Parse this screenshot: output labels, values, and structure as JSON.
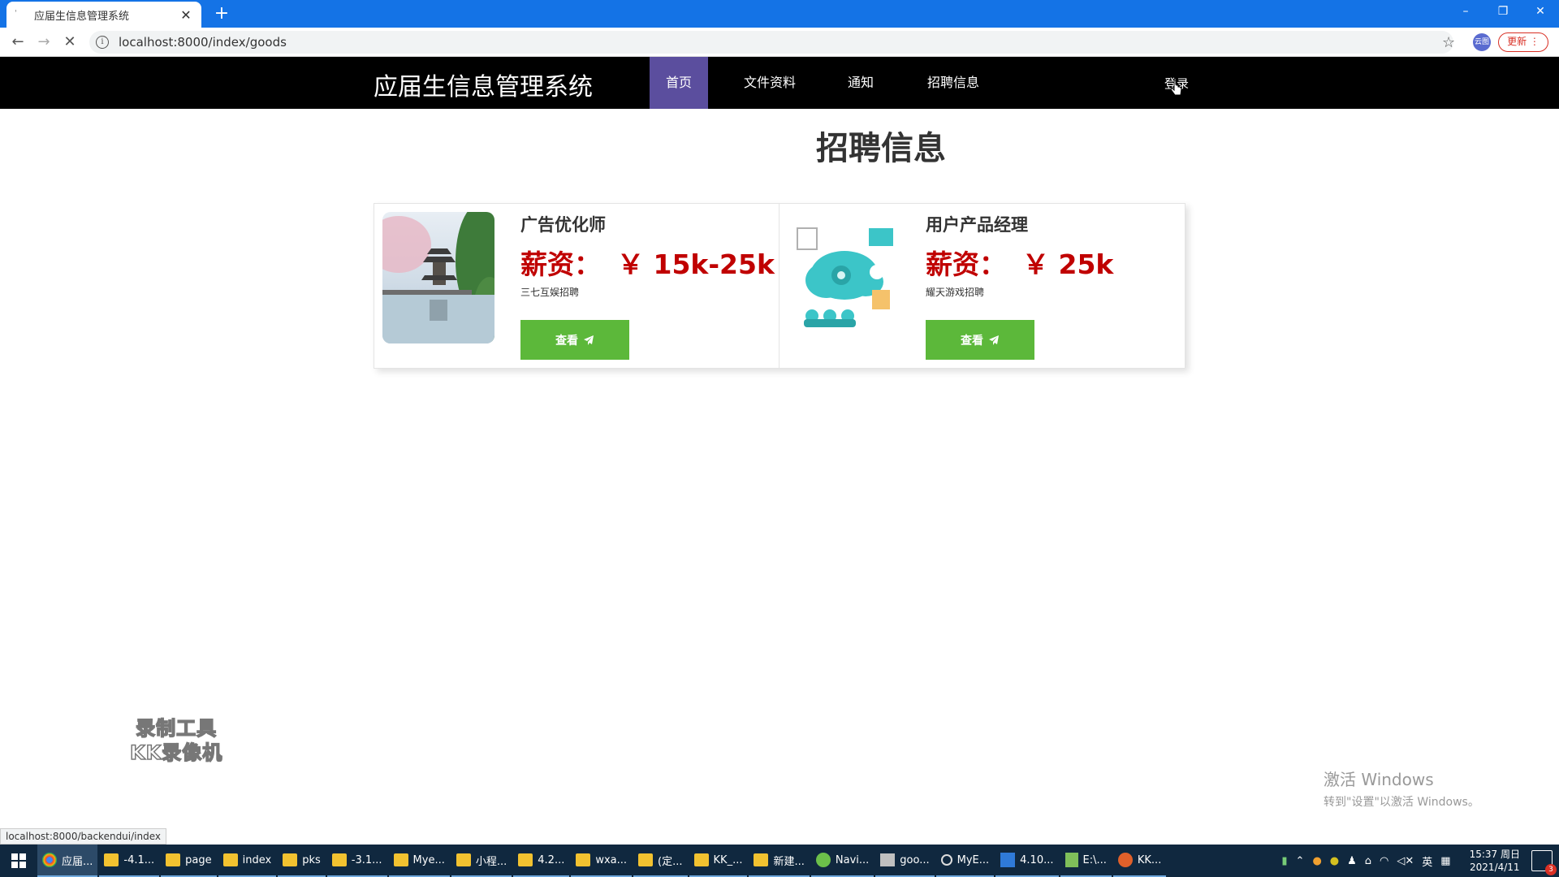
{
  "browser": {
    "tab_title": "应届生信息管理系统",
    "new_tab": "+",
    "url": "localhost:8000/index/goods",
    "update_label": "更新",
    "profile_label": "云图",
    "window_controls": [
      "–",
      "❐",
      "✕"
    ]
  },
  "site": {
    "title": "应届生信息管理系统",
    "nav": [
      {
        "label": "首页",
        "active": true
      },
      {
        "label": "文件资料",
        "active": false
      },
      {
        "label": "通知",
        "active": false
      },
      {
        "label": "招聘信息",
        "active": false
      }
    ],
    "login_label": "登录"
  },
  "main": {
    "heading": "招聘信息",
    "jobs": [
      {
        "title": "广告优化师",
        "salary_label": "薪资：",
        "salary_value": "￥ 15k-25k",
        "company": "三七互娱招聘",
        "button_label": "查看",
        "image_icon": "pagoda-lake-photo"
      },
      {
        "title": "用户产品经理",
        "salary_label": "薪资：",
        "salary_value": "￥ 25k",
        "company": "耀天游戏招聘",
        "button_label": "查看",
        "image_icon": "cloud-network-illustration"
      }
    ]
  },
  "overlays": {
    "recorder_line1": "录制工具",
    "recorder_line2": "KK录像机",
    "activate_title": "激活 Windows",
    "activate_sub": "转到\"设置\"以激活 Windows。",
    "status_url": "localhost:8000/backendui/index"
  },
  "taskbar": {
    "apps": [
      {
        "label": "应届...",
        "type": "chrome",
        "active": true
      },
      {
        "label": "-4.1...",
        "type": "folder"
      },
      {
        "label": "page",
        "type": "folder"
      },
      {
        "label": "index",
        "type": "folder"
      },
      {
        "label": "pks",
        "type": "folder"
      },
      {
        "label": "-3.1...",
        "type": "folder"
      },
      {
        "label": "Mye...",
        "type": "folder"
      },
      {
        "label": "小程...",
        "type": "folder"
      },
      {
        "label": "4.2...",
        "type": "folder"
      },
      {
        "label": "wxa...",
        "type": "folder"
      },
      {
        "label": "(定...",
        "type": "folder"
      },
      {
        "label": "KK_...",
        "type": "folder"
      },
      {
        "label": "新建...",
        "type": "folder"
      },
      {
        "label": "Navi...",
        "type": "navicat"
      },
      {
        "label": "goo...",
        "type": "drive"
      },
      {
        "label": "MyE...",
        "type": "myeclipse"
      },
      {
        "label": "4.10...",
        "type": "vscode"
      },
      {
        "label": "E:\\...",
        "type": "notepad"
      },
      {
        "label": "KK...",
        "type": "kk"
      }
    ],
    "ime": "英",
    "time": "15:37 周日",
    "date": "2021/4/11",
    "notification_count": "3"
  },
  "colors": {
    "nav_active": "#5b4e9e",
    "salary": "#c00000",
    "button": "#5cb83a",
    "tabbar": "#1473e6",
    "taskbar": "#10283f"
  }
}
